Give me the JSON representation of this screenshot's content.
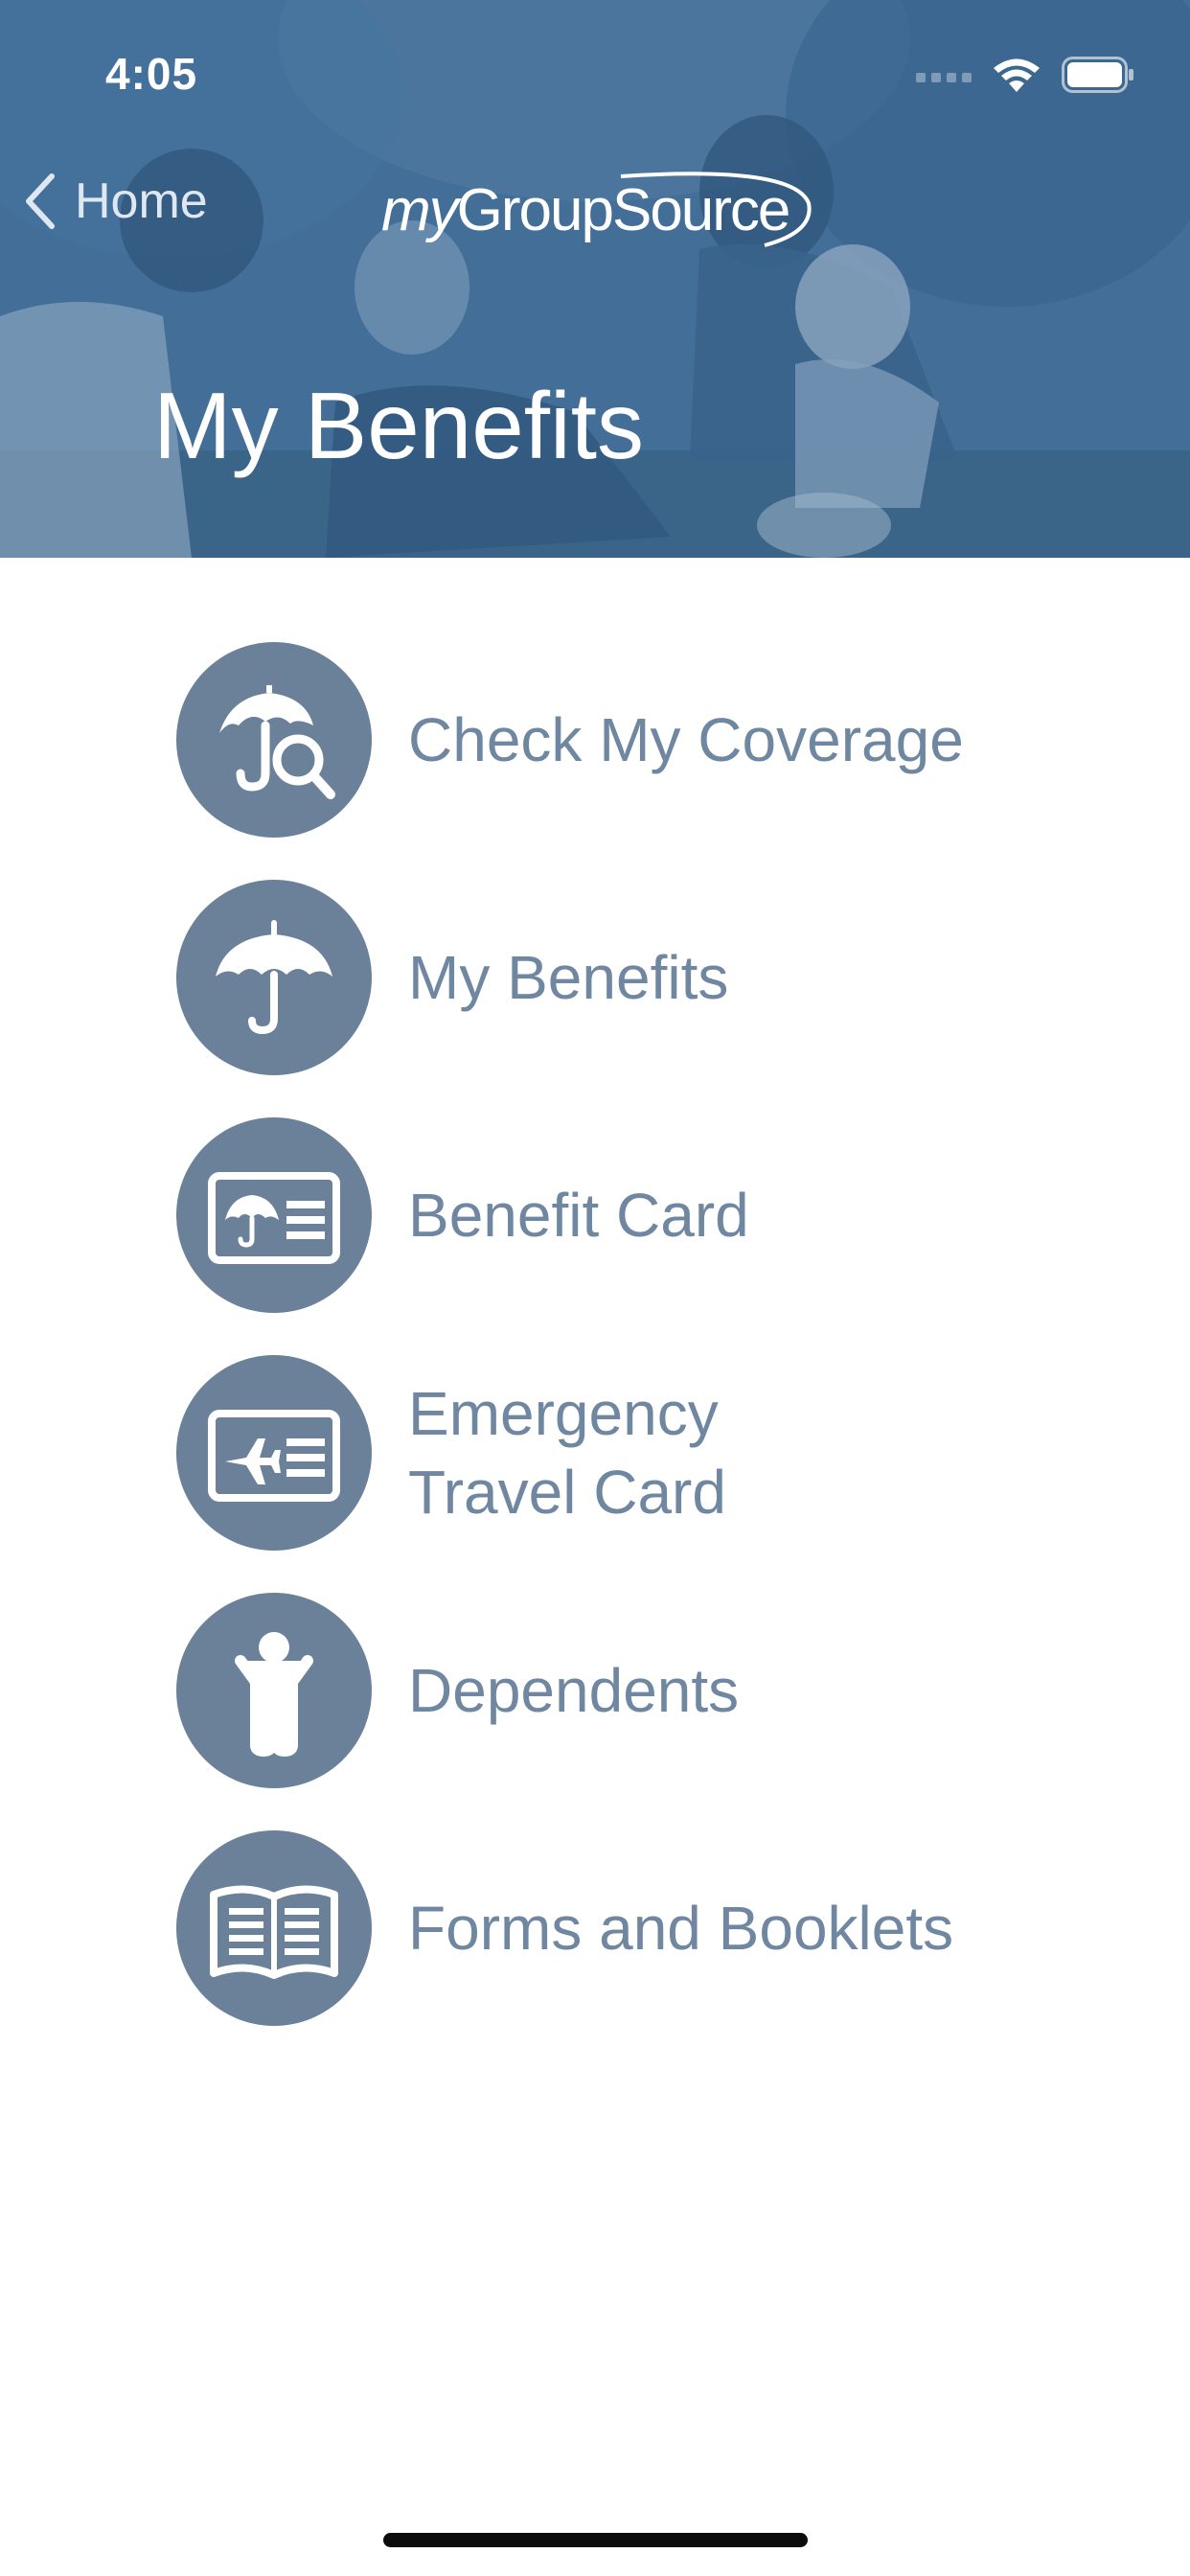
{
  "status_bar": {
    "time": "4:05",
    "icons": [
      "signal-icon",
      "wifi-icon",
      "battery-icon"
    ]
  },
  "nav": {
    "back_label": "Home",
    "logo_prefix": "my",
    "logo_main": "GroupSource"
  },
  "header": {
    "title": "My Benefits"
  },
  "menu": {
    "items": [
      {
        "label": "Check My Coverage",
        "icon": "umbrella-search-icon"
      },
      {
        "label": "My Benefits",
        "icon": "umbrella-icon"
      },
      {
        "label": "Benefit Card",
        "icon": "benefit-card-icon"
      },
      {
        "label": "Emergency\nTravel Card",
        "icon": "travel-card-icon"
      },
      {
        "label": "Dependents",
        "icon": "person-icon"
      },
      {
        "label": "Forms and Booklets",
        "icon": "booklet-icon"
      }
    ]
  },
  "colors": {
    "header_tint": "#3f6a93",
    "icon_circle": "#6a8199",
    "label_text": "#6f87a1"
  }
}
